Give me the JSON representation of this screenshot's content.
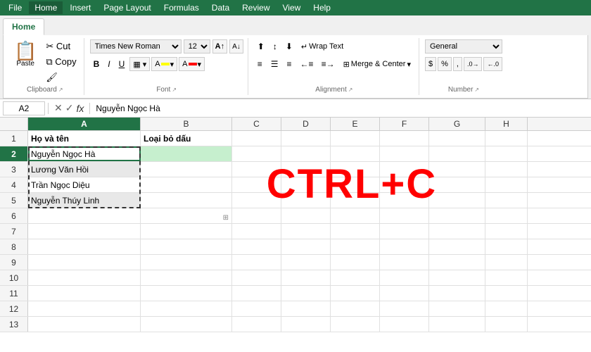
{
  "menu": {
    "items": [
      "File",
      "Home",
      "Insert",
      "Page Layout",
      "Formulas",
      "Data",
      "Review",
      "View",
      "Help"
    ]
  },
  "ribbon": {
    "active_tab": "Home",
    "clipboard": {
      "label": "Clipboard",
      "paste_label": "Paste",
      "copy_icon": "📋",
      "cut_icon": "✂",
      "copy_btn_icon": "⧉",
      "format_painter_icon": "🖌"
    },
    "font": {
      "label": "Font",
      "font_name": "Times New Roman",
      "font_size": "12",
      "bold": "B",
      "italic": "I",
      "underline": "U",
      "increase_size": "A",
      "decrease_size": "A"
    },
    "alignment": {
      "label": "Alignment",
      "wrap_text": "Wrap Text",
      "merge_center": "Merge & Center"
    },
    "number": {
      "label": "Number",
      "format": "General",
      "dollar": "$",
      "percent": "%",
      "comma": ",",
      "increase_decimal": ".00",
      "decrease_decimal": ".0"
    }
  },
  "formula_bar": {
    "cell_ref": "A2",
    "formula_value": "Nguyễn Ngọc Hà",
    "cancel_icon": "✕",
    "confirm_icon": "✓",
    "fx_icon": "fx"
  },
  "spreadsheet": {
    "columns": [
      "A",
      "B",
      "C",
      "D",
      "E",
      "F",
      "G",
      "H"
    ],
    "active_col": "A",
    "active_row": 2,
    "ctrl_c_label": "CTRL+C",
    "rows": [
      {
        "row": 1,
        "cells": [
          "Họ và tên",
          "Loại bỏ dấu",
          "",
          "",
          "",
          "",
          "",
          ""
        ]
      },
      {
        "row": 2,
        "cells": [
          "Nguyễn Ngọc Hà",
          "",
          "",
          "",
          "",
          "",
          "",
          ""
        ]
      },
      {
        "row": 3,
        "cells": [
          "Lương Văn Hồi",
          "",
          "",
          "",
          "",
          "",
          "",
          ""
        ]
      },
      {
        "row": 4,
        "cells": [
          "Trần Ngọc Diệu",
          "",
          "",
          "",
          "",
          "",
          "",
          ""
        ]
      },
      {
        "row": 5,
        "cells": [
          "Nguyễn Thúy Linh",
          "",
          "",
          "",
          "",
          "",
          "",
          ""
        ]
      },
      {
        "row": 6,
        "cells": [
          "",
          "",
          "",
          "",
          "",
          "",
          "",
          ""
        ]
      },
      {
        "row": 7,
        "cells": [
          "",
          "",
          "",
          "",
          "",
          "",
          "",
          ""
        ]
      },
      {
        "row": 8,
        "cells": [
          "",
          "",
          "",
          "",
          "",
          "",
          "",
          ""
        ]
      },
      {
        "row": 9,
        "cells": [
          "",
          "",
          "",
          "",
          "",
          "",
          "",
          ""
        ]
      },
      {
        "row": 10,
        "cells": [
          "",
          "",
          "",
          "",
          "",
          "",
          "",
          ""
        ]
      },
      {
        "row": 11,
        "cells": [
          "",
          "",
          "",
          "",
          "",
          "",
          "",
          ""
        ]
      },
      {
        "row": 12,
        "cells": [
          "",
          "",
          "",
          "",
          "",
          "",
          "",
          ""
        ]
      },
      {
        "row": 13,
        "cells": [
          "",
          "",
          "",
          "",
          "",
          "",
          "",
          ""
        ]
      }
    ]
  }
}
